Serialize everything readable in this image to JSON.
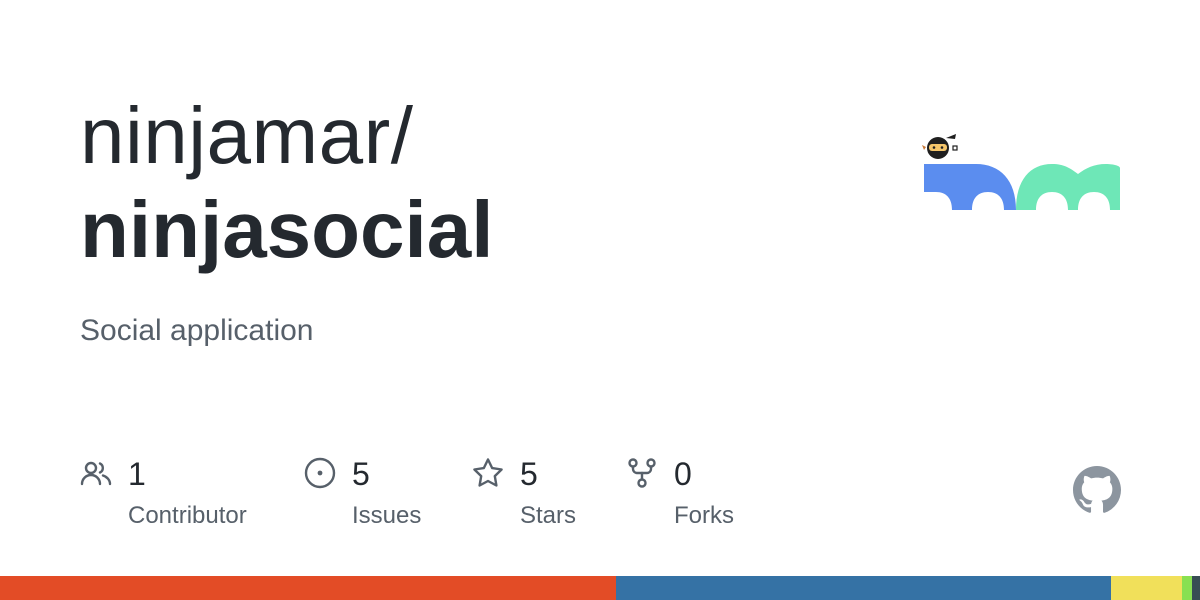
{
  "repo": {
    "owner": "ninjamar/",
    "name": "ninjasocial",
    "description": "Social application"
  },
  "stats": [
    {
      "icon": "people-icon",
      "count": "1",
      "label": "Contributor"
    },
    {
      "icon": "issue-opened-icon",
      "count": "5",
      "label": "Issues"
    },
    {
      "icon": "star-icon",
      "count": "5",
      "label": "Stars"
    },
    {
      "icon": "repo-forked-icon",
      "count": "0",
      "label": "Forks"
    }
  ],
  "logo": {
    "icon": "ninja-mascot-logo",
    "colors": {
      "blue": "#5b8def",
      "green": "#6ee7b7",
      "dark": "#1f1f1f",
      "skin": "#f5c66b"
    }
  },
  "github_mark": {
    "icon": "github-octocat-icon",
    "color": "#8c959f"
  },
  "languages": [
    {
      "share": 51.3,
      "color": "#e34c26"
    },
    {
      "share": 41.3,
      "color": "#3572a5"
    },
    {
      "share": 5.9,
      "color": "#f1e05a"
    },
    {
      "share": 0.8,
      "color": "#89e051"
    },
    {
      "share": 0.7,
      "color": "#384d54"
    }
  ]
}
